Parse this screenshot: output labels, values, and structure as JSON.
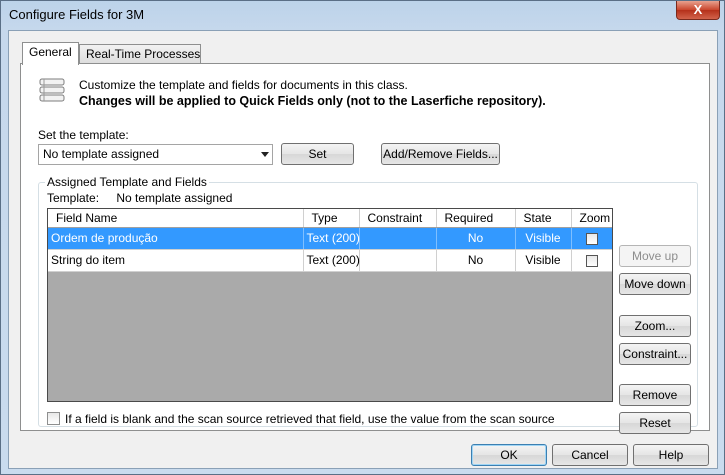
{
  "window": {
    "title": "Configure Fields for 3M",
    "close_glyph": "X"
  },
  "tabs": [
    {
      "label": "General"
    },
    {
      "label": "Real-Time Processes"
    }
  ],
  "info": {
    "line1": "Customize the template and fields for documents in this class.",
    "line2": "Changes will be applied to Quick Fields only (not to the Laserfiche repository)."
  },
  "template": {
    "label": "Set the template:",
    "selected": "No template assigned",
    "set_button": "Set",
    "add_remove_button": "Add/Remove Fields..."
  },
  "assigned": {
    "group_title": "Assigned Template and Fields",
    "template_label": "Template:",
    "template_value": "No template assigned"
  },
  "grid": {
    "columns": [
      "Field Name",
      "Type",
      "Constraint",
      "Required",
      "State",
      "Zoom"
    ],
    "rows": [
      {
        "field_name": "Ordem de produção",
        "type": "Text (200)",
        "constraint": "",
        "required": "No",
        "state": "Visible",
        "zoom": false,
        "selected": true
      },
      {
        "field_name": "String do item",
        "type": "Text (200)",
        "constraint": "",
        "required": "No",
        "state": "Visible",
        "zoom": false,
        "selected": false
      }
    ]
  },
  "side_buttons": {
    "move_up": "Move up",
    "move_down": "Move down",
    "zoom": "Zoom...",
    "constraint": "Constraint...",
    "remove": "Remove",
    "reset": "Reset"
  },
  "scan_source_option": {
    "label": "If a field is blank and the scan source retrieved that field, use the value from the scan source",
    "checked": false
  },
  "footer": {
    "ok": "OK",
    "cancel": "Cancel",
    "help": "Help"
  },
  "colors": {
    "selection": "#3399ff",
    "grid_background": "#aaaaaa"
  }
}
